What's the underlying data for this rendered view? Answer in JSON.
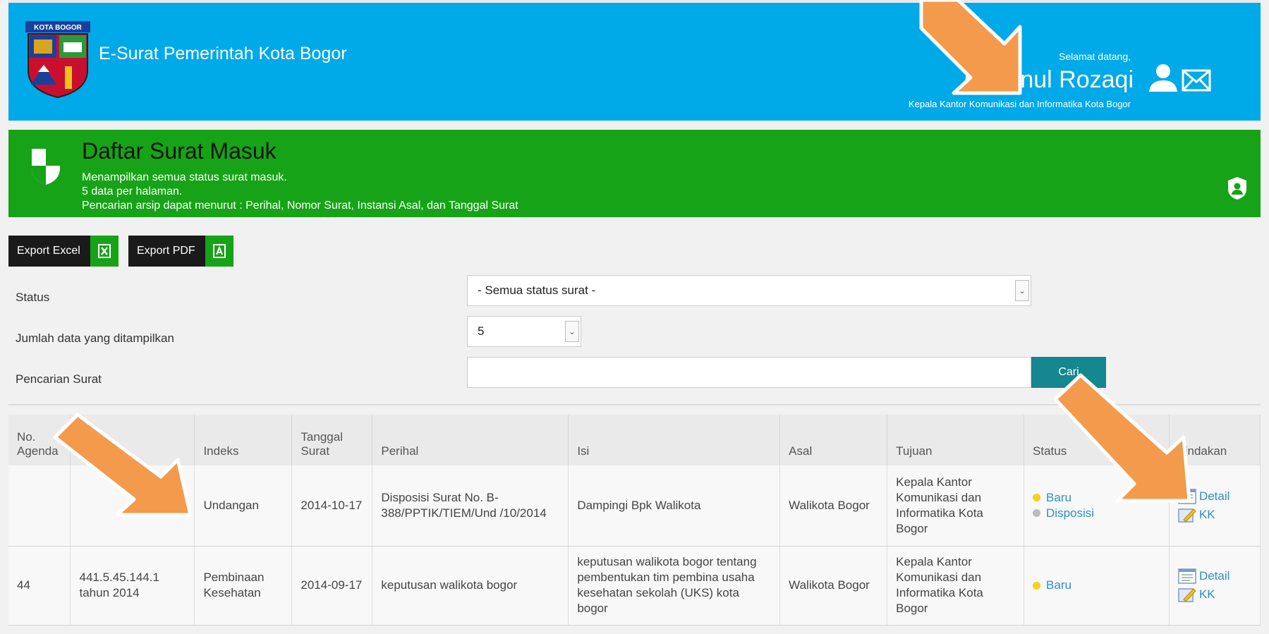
{
  "header": {
    "logo_text": "KOTA BOGOR",
    "app_title": "E-Surat Pemerintah Kota Bogor",
    "welcome": "Selamat datang,",
    "user_name": "Chusnul Rozaqi",
    "user_role": "Kepala Kantor Komunikasi dan Informatika Kota Bogor"
  },
  "banner": {
    "title": "Daftar Surat Masuk",
    "desc_1": "Menampilkan semua status surat masuk.",
    "desc_2": "5 data per halaman.",
    "desc_3": "Pencarian arsip dapat menurut : Perihal, Nomor Surat, Instansi Asal, dan Tanggal Surat"
  },
  "toolbar": {
    "export_excel": "Export Excel",
    "export_pdf": "Export PDF"
  },
  "filters": {
    "status_label": "Status",
    "status_value": "- Semua status surat -",
    "count_label": "Jumlah data yang ditampilkan",
    "count_value": "5",
    "search_label": "Pencarian Surat",
    "search_value": "",
    "search_button": "Cari"
  },
  "table": {
    "headers": [
      "No. Agenda",
      "",
      "Indeks",
      "Tanggal Surat",
      "Perihal",
      "Isi",
      "Asal",
      "Tujuan",
      "Status",
      "Tindakan"
    ],
    "rows": [
      {
        "no_agenda": "",
        "nomor": "",
        "indeks": "Undangan",
        "tanggal": "2014-10-17",
        "perihal": "Disposisi Surat No. B-388/PPTIK/TIEM/Und /10/2014",
        "isi": "Dampingi Bpk Walikota",
        "asal": "Walikota Bogor",
        "tujuan": "Kepala Kantor Komunikasi dan Informatika Kota Bogor",
        "status_1": "Baru",
        "status_2": "Disposisi",
        "action_1": "Detail",
        "action_2": "KK"
      },
      {
        "no_agenda": "44",
        "nomor": "441.5.45.144.1 tahun 2014",
        "indeks": "Pembinaan Kesehatan",
        "tanggal": "2014-09-17",
        "perihal": "keputusan walikota bogor",
        "isi": "keputusan walikota bogor tentang pembentukan tim pembina usaha kesehatan sekolah (UKS) kota bogor",
        "asal": "Walikota Bogor",
        "tujuan": "Kepala Kantor Komunikasi dan Informatika Kota Bogor",
        "status_1": "Baru",
        "action_1": "Detail",
        "action_2": "KK"
      }
    ]
  },
  "colors": {
    "header_blue": "#00a9e8",
    "banner_green": "#17a317",
    "search_teal": "#14878f",
    "annotation_orange": "#f39a4c"
  }
}
